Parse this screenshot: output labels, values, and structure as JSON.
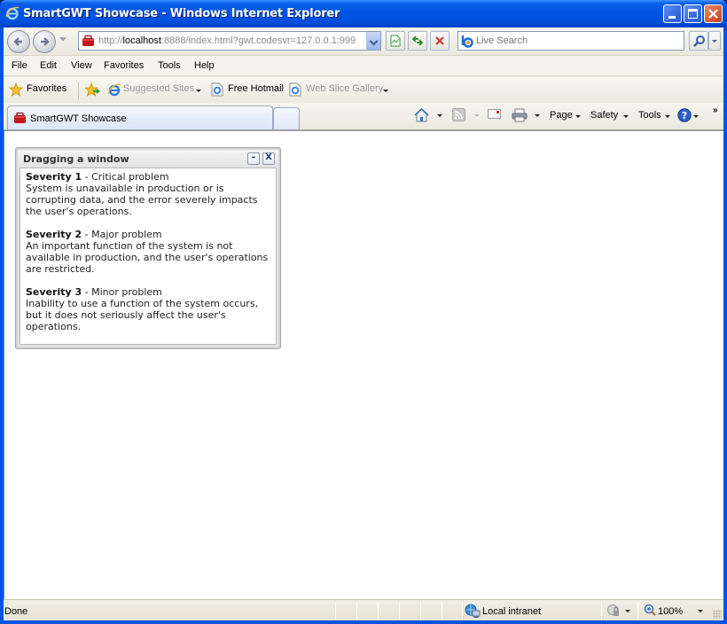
{
  "window": {
    "title": "SmartGWT Showcase - Windows Internet Explorer",
    "controls": {
      "minimize": "minimize",
      "maximize": "maximize",
      "close": "close"
    }
  },
  "navigation": {
    "address_prefix": "http://",
    "address_host": "localhost",
    "address_rest": ":8888/index.html?gwt.codesvr=127.0.0.1:999",
    "search_placeholder": "Live Search"
  },
  "menubar": {
    "items": [
      "File",
      "Edit",
      "View",
      "Favorites",
      "Tools",
      "Help"
    ]
  },
  "favorites_bar": {
    "favorites_label": "Favorites",
    "links": [
      {
        "label": "Suggested Sites",
        "dimmed": true,
        "has_dropdown": true
      },
      {
        "label": "Free Hotmail",
        "dimmed": false,
        "has_dropdown": false
      },
      {
        "label": "Web Slice Gallery",
        "dimmed": true,
        "has_dropdown": true
      }
    ]
  },
  "tabs": {
    "active_tab_label": "SmartGWT Showcase",
    "command_bar": {
      "page": "Page",
      "safety": "Safety",
      "tools": "Tools",
      "overflow": "»"
    }
  },
  "sg_window": {
    "title": "Dragging a window",
    "minimize_glyph": "–",
    "close_glyph": "X",
    "severities": [
      {
        "heading": "Severity 1",
        "summary": " - Critical problem",
        "description": "System is unavailable in production or is corrupting data, and the error severely impacts the user's operations."
      },
      {
        "heading": "Severity 2",
        "summary": " - Major problem",
        "description": "An important function of the system is not available in production, and the user's operations are restricted."
      },
      {
        "heading": "Severity 3",
        "summary": " - Minor problem",
        "description": "Inability to use a function of the system occurs, but it does not seriously affect the user's operations."
      }
    ]
  },
  "statusbar": {
    "status": "Done",
    "zone": "Local intranet",
    "zoom": "100%"
  }
}
